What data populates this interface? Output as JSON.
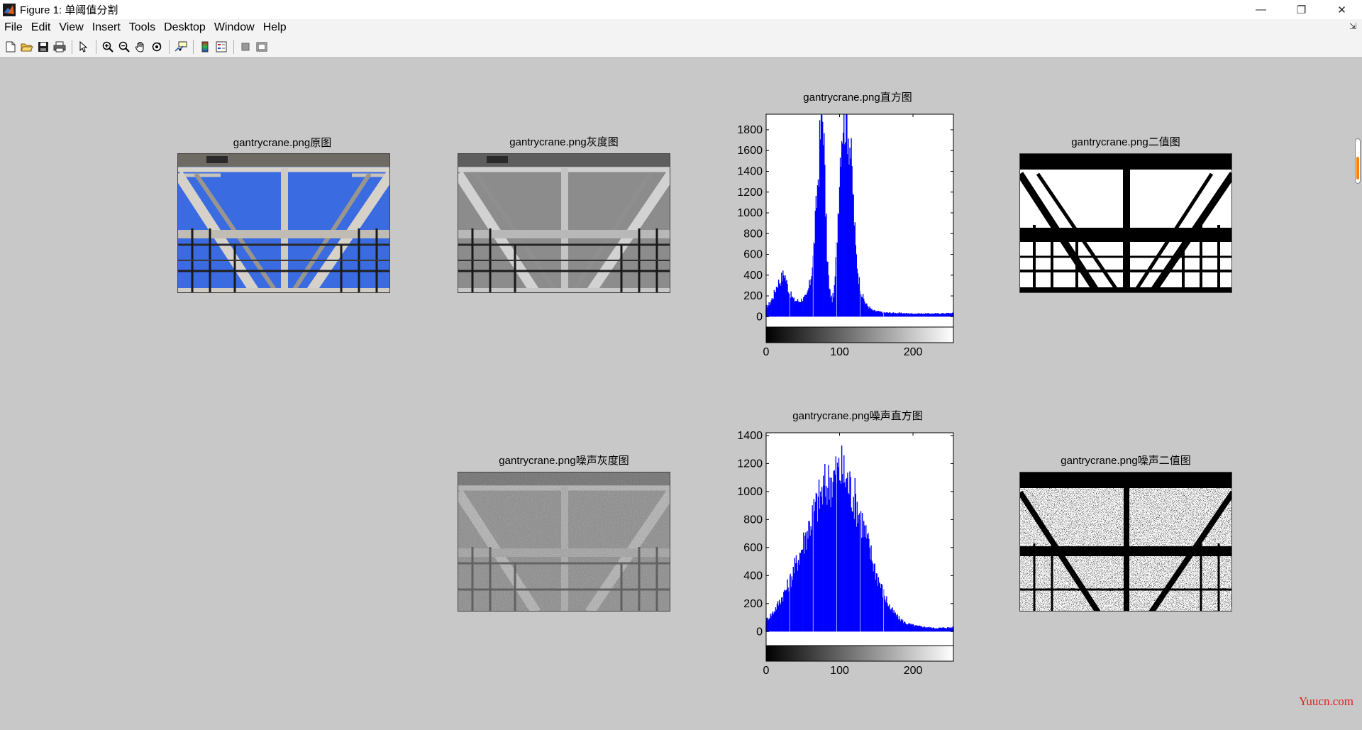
{
  "window": {
    "title": "Figure 1: 单阈值分割",
    "controls": {
      "minimize": "—",
      "restore": "❐",
      "close": "✕"
    }
  },
  "menu": {
    "items": [
      {
        "label": "File"
      },
      {
        "label": "Edit"
      },
      {
        "label": "View"
      },
      {
        "label": "Insert"
      },
      {
        "label": "Tools"
      },
      {
        "label": "Desktop"
      },
      {
        "label": "Window"
      },
      {
        "label": "Help"
      }
    ],
    "pin_glyph": "⇲"
  },
  "toolbar": {
    "buttons": [
      "new-icon",
      "open-icon",
      "save-icon",
      "print-icon",
      "pointer-icon",
      "zoom-in-icon",
      "zoom-out-icon",
      "pan-icon",
      "rotate-icon",
      "data-cursor-icon",
      "colorbar-icon",
      "legend-icon",
      "hide-tools-icon",
      "show-tools-icon"
    ]
  },
  "axes": {
    "original": {
      "title": "gantrycrane.png原图"
    },
    "gray": {
      "title": "gantrycrane.png灰度图"
    },
    "hist": {
      "title": "gantrycrane.png直方图"
    },
    "binary": {
      "title": "gantrycrane.png二值图"
    },
    "noise_gray": {
      "title": "gantrycrane.png噪声灰度图"
    },
    "noise_hist": {
      "title": "gantrycrane.png噪声直方图"
    },
    "noise_binary": {
      "title": "gantrycrane.png噪声二值图"
    }
  },
  "chart_data": [
    {
      "type": "bar",
      "title": "gantrycrane.png直方图",
      "xlim": [
        0,
        255
      ],
      "ylim": [
        -100,
        1950
      ],
      "xticks": [
        0,
        100,
        200
      ],
      "yticks": [
        0,
        200,
        400,
        600,
        800,
        1000,
        1200,
        1400,
        1600,
        1800
      ],
      "bar_color": "#0000ff",
      "profile": [
        [
          0,
          90
        ],
        [
          5,
          130
        ],
        [
          10,
          200
        ],
        [
          15,
          310
        ],
        [
          20,
          360
        ],
        [
          25,
          420
        ],
        [
          28,
          330
        ],
        [
          32,
          230
        ],
        [
          38,
          160
        ],
        [
          45,
          150
        ],
        [
          55,
          190
        ],
        [
          60,
          330
        ],
        [
          64,
          560
        ],
        [
          68,
          1000
        ],
        [
          72,
          1500
        ],
        [
          75,
          1900
        ],
        [
          78,
          1950
        ],
        [
          80,
          1300
        ],
        [
          83,
          620
        ],
        [
          86,
          260
        ],
        [
          90,
          160
        ],
        [
          93,
          260
        ],
        [
          96,
          650
        ],
        [
          99,
          1200
        ],
        [
          102,
          1750
        ],
        [
          105,
          1950
        ],
        [
          110,
          1950
        ],
        [
          115,
          1600
        ],
        [
          119,
          1100
        ],
        [
          122,
          650
        ],
        [
          126,
          380
        ],
        [
          130,
          220
        ],
        [
          136,
          120
        ],
        [
          145,
          60
        ],
        [
          160,
          40
        ],
        [
          200,
          30
        ],
        [
          230,
          30
        ],
        [
          255,
          35
        ]
      ]
    },
    {
      "type": "bar",
      "title": "gantrycrane.png噪声直方图",
      "xlim": [
        0,
        255
      ],
      "ylim": [
        -100,
        1420
      ],
      "xticks": [
        0,
        100,
        200
      ],
      "yticks": [
        0,
        200,
        400,
        600,
        800,
        1000,
        1200,
        1400
      ],
      "bar_color": "#0000ff",
      "profile": [
        [
          0,
          80
        ],
        [
          10,
          140
        ],
        [
          20,
          230
        ],
        [
          30,
          330
        ],
        [
          40,
          470
        ],
        [
          50,
          620
        ],
        [
          60,
          780
        ],
        [
          70,
          920
        ],
        [
          80,
          1030
        ],
        [
          90,
          1090
        ],
        [
          97,
          1130
        ],
        [
          103,
          1150
        ],
        [
          110,
          1080
        ],
        [
          120,
          960
        ],
        [
          130,
          800
        ],
        [
          140,
          600
        ],
        [
          150,
          420
        ],
        [
          160,
          270
        ],
        [
          170,
          160
        ],
        [
          180,
          100
        ],
        [
          190,
          60
        ],
        [
          205,
          40
        ],
        [
          230,
          25
        ],
        [
          255,
          30
        ]
      ]
    }
  ],
  "watermark": "Yuucn.com"
}
